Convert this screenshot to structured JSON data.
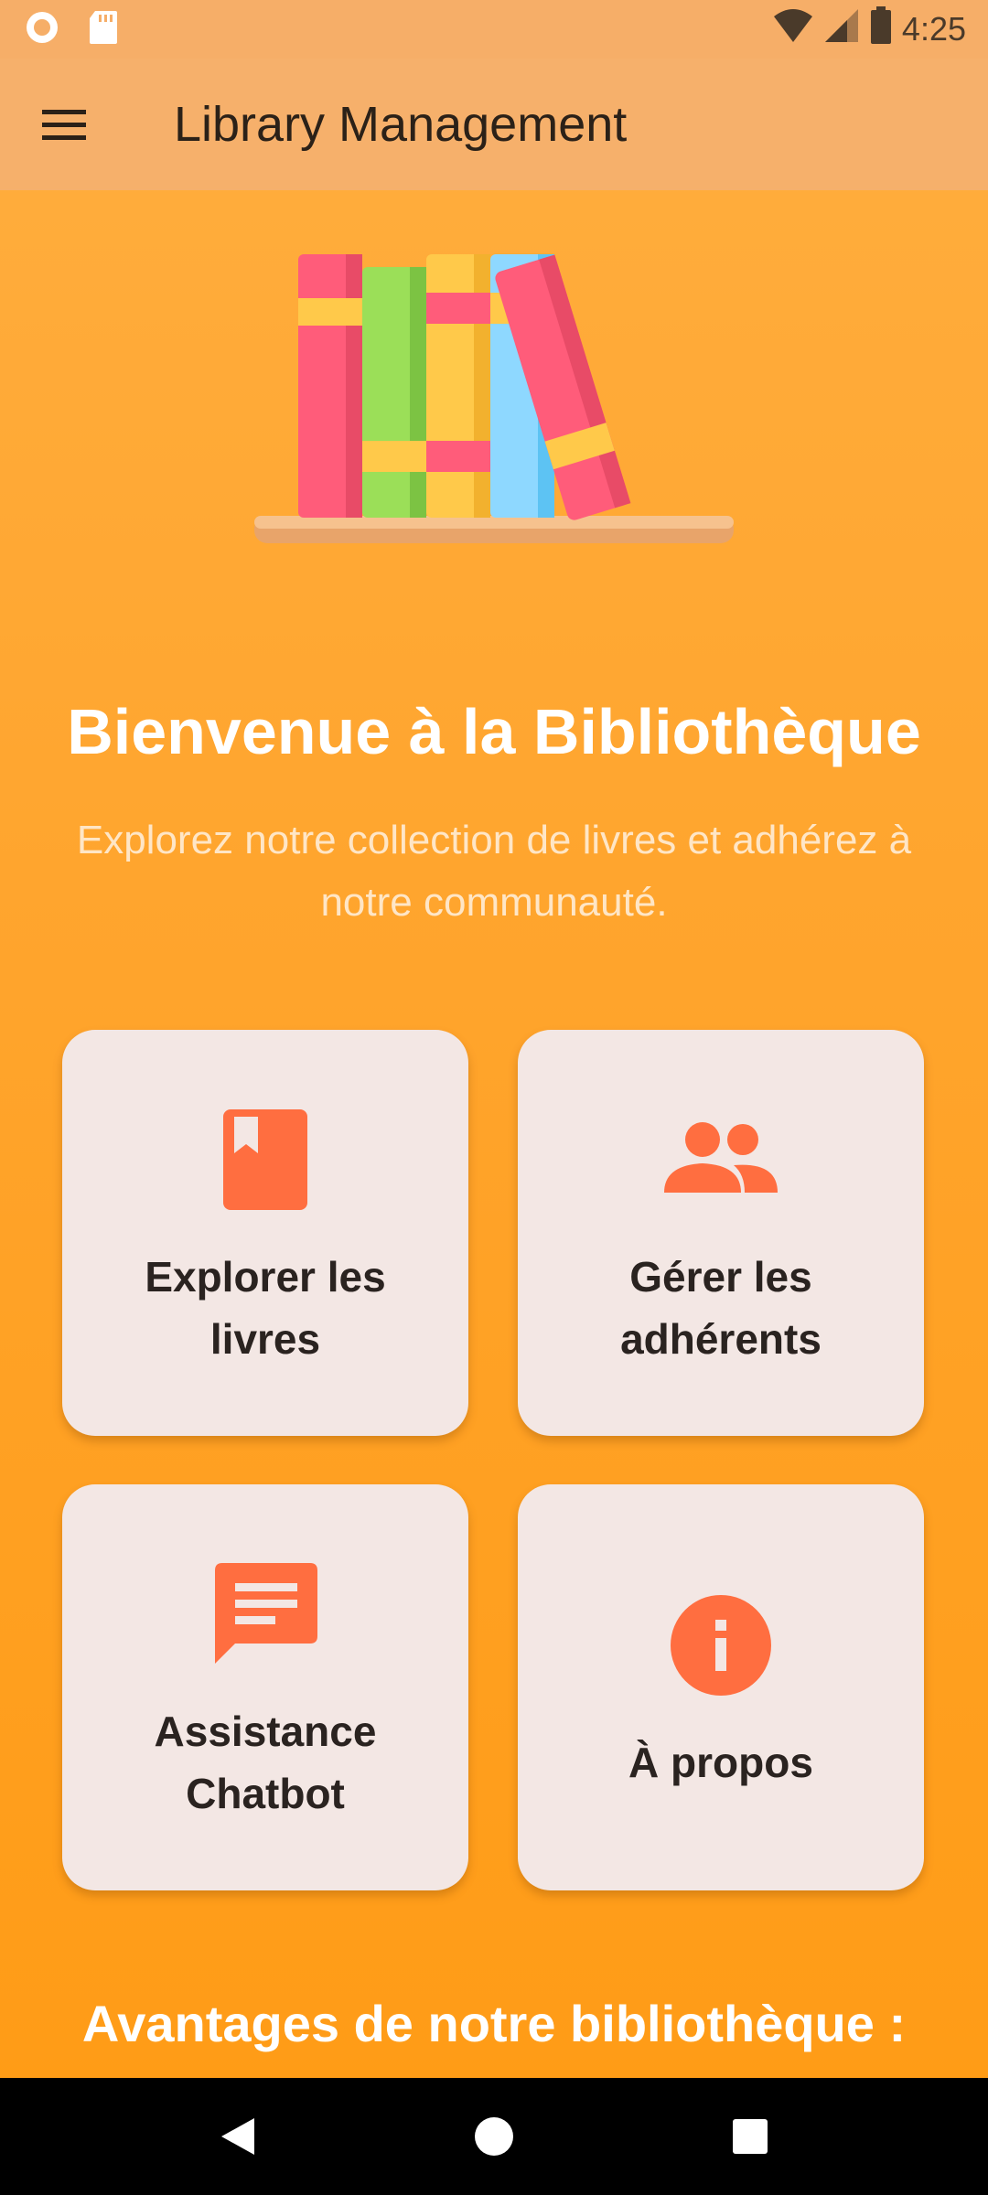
{
  "status_bar": {
    "time": "4:25",
    "icons": [
      "circle-notification-icon",
      "sd-card-icon",
      "wifi-icon",
      "signal-icon",
      "battery-icon"
    ]
  },
  "app_bar": {
    "title": "Library Management",
    "menu_icon": "hamburger-menu-icon"
  },
  "hero": {
    "illustration": "books-on-shelf"
  },
  "welcome": {
    "title": "Bienvenue à la Bibliothèque",
    "subtitle": "Explorez notre collection de livres et adhérez à notre communauté."
  },
  "cards": [
    {
      "label": "Explorer les livres",
      "icon": "book-icon"
    },
    {
      "label": "Gérer les adhérents",
      "icon": "people-icon"
    },
    {
      "label": "Assistance Chatbot",
      "icon": "chat-icon"
    },
    {
      "label": "À propos",
      "icon": "info-icon"
    }
  ],
  "section_title": "Avantages de notre bibliothèque :",
  "nav_bar": {
    "buttons": [
      "back-icon",
      "home-icon",
      "recents-icon"
    ]
  },
  "colors": {
    "background": "#FFA52E",
    "app_bar": "#F6B06B",
    "card": "#F3E7E4",
    "icon_accent": "#FF6E40"
  }
}
